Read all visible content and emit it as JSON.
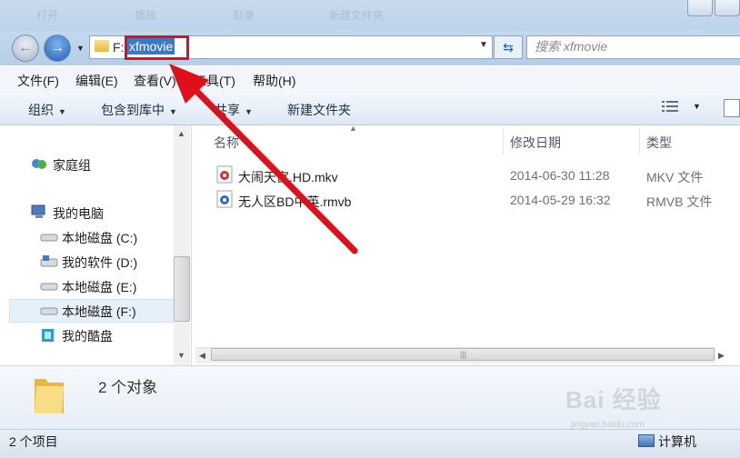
{
  "title_strip": {
    "ghost_items": [
      "打开",
      "播放",
      "刻录",
      "新建文件夹"
    ]
  },
  "address": {
    "drive": "F:",
    "selected_folder": "xfmovie"
  },
  "search": {
    "placeholder": "搜索 xfmovie"
  },
  "menu": {
    "items": [
      "文件(F)",
      "编辑(E)",
      "查看(V)",
      "工具(T)",
      "帮助(H)"
    ]
  },
  "toolbar": {
    "organize": "组织",
    "include_library": "包含到库中",
    "share": "共享",
    "new_folder": "新建文件夹"
  },
  "navpane": {
    "homegroup": "家庭组",
    "computer": "我的电脑",
    "drives": [
      "本地磁盘 (C:)",
      "我的软件 (D:)",
      "本地磁盘 (E:)",
      "本地磁盘 (F:)"
    ],
    "cloud": "我的酷盘",
    "selected": "本地磁盘 (F:)"
  },
  "columns": {
    "name": "名称",
    "date": "修改日期",
    "type": "类型"
  },
  "files": [
    {
      "name": "大闹天宫.HD.mkv",
      "date": "2014-06-30 11:28",
      "type": "MKV 文件",
      "icon": "mkv-video-icon"
    },
    {
      "name": "无人区BD中英.rmvb",
      "date": "2014-05-29 16:32",
      "type": "RMVB 文件",
      "icon": "rmvb-video-icon"
    }
  ],
  "details": {
    "count": "2 个对象"
  },
  "status": {
    "items": "2 个项目",
    "location": "计算机"
  },
  "watermark": {
    "text": "Bai 经验",
    "sub": "jingyan.baidu.com"
  },
  "colors": {
    "accent": "#3a78c8",
    "highlight_box": "#e0101a",
    "arrow": "#e0101a"
  }
}
